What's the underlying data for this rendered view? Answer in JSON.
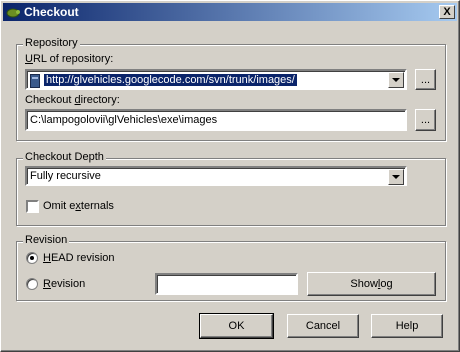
{
  "window": {
    "title": "Checkout",
    "close_label": "X"
  },
  "repository": {
    "group_label": "Repository",
    "url_label_underlined": "U",
    "url_label_rest": "RL of repository:",
    "url_value": "http://glvehicles.googlecode.com/svn/trunk/images/",
    "browse_url_label": "...",
    "dir_label_pre": "Checkout ",
    "dir_label_underlined": "d",
    "dir_label_post": "irectory:",
    "dir_value": "C:\\lampogolovii\\glVehicles\\exe\\images",
    "browse_dir_label": "..."
  },
  "depth": {
    "group_label": "Checkout Depth",
    "selected": "Fully recursive",
    "omit_pre": "Omit e",
    "omit_underlined": "x",
    "omit_post": "ternals",
    "omit_checked": false
  },
  "revision": {
    "group_label": "Revision",
    "head_underlined": "H",
    "head_rest": "EAD revision",
    "rev_underlined": "R",
    "rev_rest": "evision",
    "selected": "head",
    "rev_value": "",
    "showlog_pre": "Show ",
    "showlog_underlined": "l",
    "showlog_post": "og"
  },
  "buttons": {
    "ok": "OK",
    "cancel": "Cancel",
    "help": "Help"
  }
}
